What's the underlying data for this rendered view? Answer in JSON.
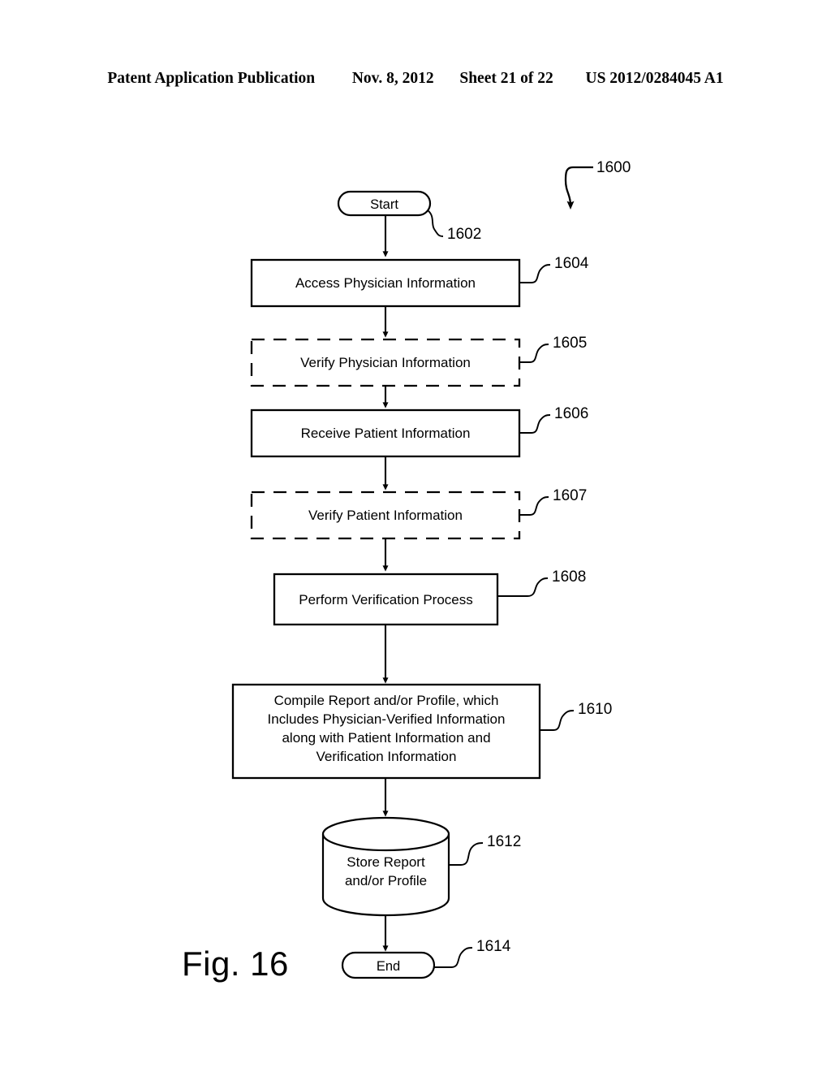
{
  "header": {
    "publication": "Patent Application Publication",
    "date": "Nov. 8, 2012",
    "sheet": "Sheet 21 of 22",
    "pub_number": "US 2012/0284045 A1"
  },
  "figure": {
    "caption": "Fig. 16",
    "diagram_ref": "1600",
    "nodes": [
      {
        "id": "start",
        "ref": "1602",
        "shape": "terminator",
        "text": "Start"
      },
      {
        "id": "access-physician",
        "ref": "1604",
        "shape": "process",
        "text": "Access Physician Information"
      },
      {
        "id": "verify-physician",
        "ref": "1605",
        "shape": "optional",
        "text": "Verify Physician Information"
      },
      {
        "id": "receive-patient",
        "ref": "1606",
        "shape": "process",
        "text": "Receive Patient Information"
      },
      {
        "id": "verify-patient",
        "ref": "1607",
        "shape": "optional",
        "text": "Verify Patient Information"
      },
      {
        "id": "perform-verify",
        "ref": "1608",
        "shape": "process",
        "text": "Perform Verification Process"
      },
      {
        "id": "compile-report",
        "ref": "1610",
        "shape": "process",
        "text": "Compile Report and/or Profile, which\nIncludes Physician-Verified Information\nalong with Patient Information and\nVerification Information"
      },
      {
        "id": "store-report",
        "ref": "1612",
        "shape": "database",
        "text": "Store Report\nand/or Profile"
      },
      {
        "id": "end",
        "ref": "1614",
        "shape": "terminator",
        "text": "End"
      }
    ]
  },
  "colors": {
    "ink": "#000000",
    "paper": "#ffffff"
  }
}
